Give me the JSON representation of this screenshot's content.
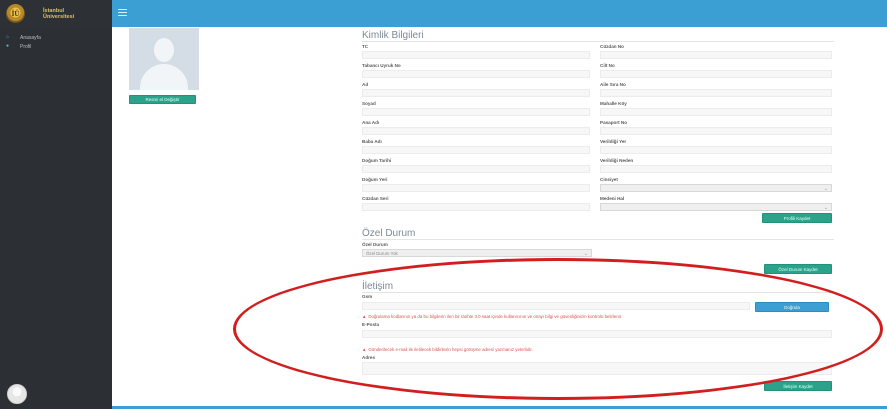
{
  "brand": {
    "logo_text": "İÜ",
    "line1": "İstanbul",
    "line2": "Üniversitesi"
  },
  "menu_icon": "hamburger-icon",
  "sidebar": {
    "items": [
      {
        "label": "Anasayfa",
        "icon": "home-icon"
      },
      {
        "label": "Profil",
        "icon": "user-icon"
      }
    ]
  },
  "profile": {
    "photo_button": "Resmi el Değiştir"
  },
  "kimlik": {
    "title": "Kimlik Bilgileri",
    "left_fields": [
      "TC",
      "Tabancı Uyruk No",
      "Ad",
      "Soyad",
      "Ana Adı",
      "Baba Adı",
      "Doğum Tarihi",
      "Doğum Yeri",
      "Cüzdan Seri"
    ],
    "right_fields": [
      "Cüzdan No",
      "Cilt No",
      "Aile Sıra No",
      "Mahalle Köy",
      "Pasaport No",
      "Verildiği Yer",
      "Verildiği Neden",
      "Cinsiyet",
      "Medeni Hal"
    ],
    "save_button": "Profili Kaydet"
  },
  "ozel": {
    "title": "Özel Durum",
    "label": "Özel Durum",
    "select_value": "Özel Durum Yok",
    "save_button": "Özel Durum Kaydet"
  },
  "iletisim": {
    "title": "İletişim",
    "gsm_label": "Gsm",
    "verify_button": "Doğrula",
    "gsm_warning": "Doğrulama kodlarının ya da bu bilgilerin ileri bir tarihte 3.0 saat içinde kullanıcının ve onayı bilgi ve güvenliğinizin kontrolü belirlenir.",
    "email_label": "E-Posta",
    "email_warning": "Gönderilecek e-mail ile iletilecek bildirilerin hepsi görüşme adresi yazmanız yeterlidir.",
    "address_label": "Adres",
    "save_button": "İletişim Kaydet"
  },
  "colors": {
    "topbar": "#3c9fd3",
    "sidebar": "#2c2f33",
    "accent_green": "#2aa38a",
    "annotation_red": "#d21e1e"
  }
}
